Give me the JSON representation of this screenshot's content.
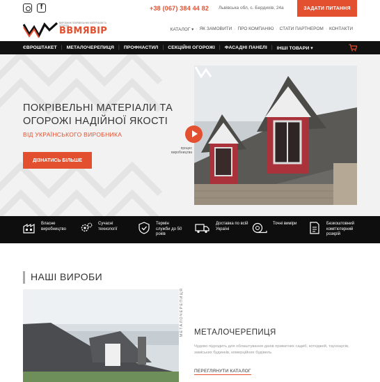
{
  "topbar": {
    "phone": "+38 (067) 384 44 82",
    "address": "Львівська обл, с. Бердихів, 24а",
    "ask_button": "ЗАДАТИ ПИТАННЯ"
  },
  "logo": {
    "text": "ВВМЯВІР",
    "subtitle": "ВИРОБНИК ПОКРІВЕЛЬНИХ МАТЕРІАЛІВ ТА ОГОРОЖ"
  },
  "topnav": {
    "items": [
      "КАТАЛОГ ▾",
      "ЯК ЗАМОВИТИ",
      "ПРО КОМПАНІЮ",
      "СТАТИ ПАРТНЕРОМ",
      "КОНТАКТИ"
    ]
  },
  "mainnav": {
    "items": [
      "ЄВРОШТАКЕТ",
      "МЕТАЛОЧЕРЕПИЦЯ",
      "ПРОФНАСТИЛ",
      "СЕКЦІЙНІ ОГОРОЖІ",
      "ФАСАДНІ ПАНЕЛІ",
      "ІНШІ ТОВАРИ ▾"
    ]
  },
  "hero": {
    "title": "ПОКРІВЕЛЬНІ МАТЕРІАЛИ ТА ОГОРОЖІ НАДІЙНОЇ ЯКОСТІ",
    "subtitle": "ВІД УКРАЇНСЬКОГО ВИРОБНИКА",
    "button": "ДІЗНАТИСЬ БІЛЬШЕ",
    "video_label": "процес виробництва"
  },
  "features": [
    {
      "icon": "factory-icon",
      "text": "Власне виробництво"
    },
    {
      "icon": "gears-icon",
      "text": "Сучасні технології"
    },
    {
      "icon": "shield-icon",
      "text": "Термін служби до 50 років"
    },
    {
      "icon": "truck-icon",
      "text": "Доставка по всій Україні"
    },
    {
      "icon": "tape-measure-icon",
      "text": "Точні виміри"
    },
    {
      "icon": "document-icon",
      "text": "Безкоштовний комп'ютерний розкрій"
    }
  ],
  "products": {
    "section_title": "НАШІ ВИРОБИ",
    "vertical_label": "МЕТАЛОЧЕРЕПИЦЯ",
    "name": "МЕТАЛОЧЕРЕПИЦЯ",
    "description": "Чудово підходить для облаштування дахів приватних садиб, котеджей, таунхаусів, заміських будинків, комерційних будівель",
    "link": "ПЕРЕГЛЯНУТИ КАТАЛОГ"
  },
  "colors": {
    "accent": "#e2502f",
    "dark": "#111111",
    "hero_bg": "#f2f2f2"
  }
}
